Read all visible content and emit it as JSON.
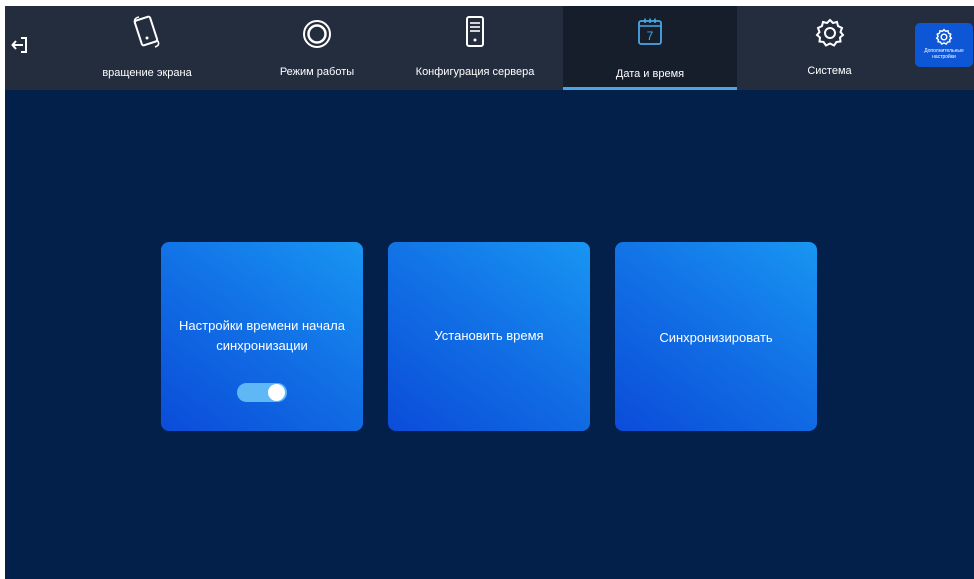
{
  "header": {
    "tabs": [
      {
        "label": "вращение экрана",
        "icon": "phone-rotate-icon",
        "active": false
      },
      {
        "label": "Режим работы",
        "icon": "ring-icon",
        "active": false
      },
      {
        "label": "Конфигурация сервера",
        "icon": "server-icon",
        "active": false
      },
      {
        "label": "Дата и время",
        "icon": "calendar-icon",
        "active": true,
        "calendar_day": "7"
      },
      {
        "label": "Система",
        "icon": "gear-icon",
        "active": false
      }
    ],
    "extra_settings": {
      "label": "Дополнительные настройки",
      "icon": "gear-icon"
    }
  },
  "main": {
    "cards": [
      {
        "label": "Настройки времени начала синхронизации",
        "toggle_on": true
      },
      {
        "label": "Установить время"
      },
      {
        "label": "Синхронизировать"
      }
    ]
  },
  "colors": {
    "background": "#03204a",
    "topbar": "#242d3e",
    "active_tab": "#161e2b",
    "accent_underline": "#4aa7e6",
    "card_gradient_light": "#1896f2",
    "card_gradient_dark": "#0b4cd9",
    "extra_button": "#0d57d6",
    "toggle_on": "#5fb8f5"
  }
}
